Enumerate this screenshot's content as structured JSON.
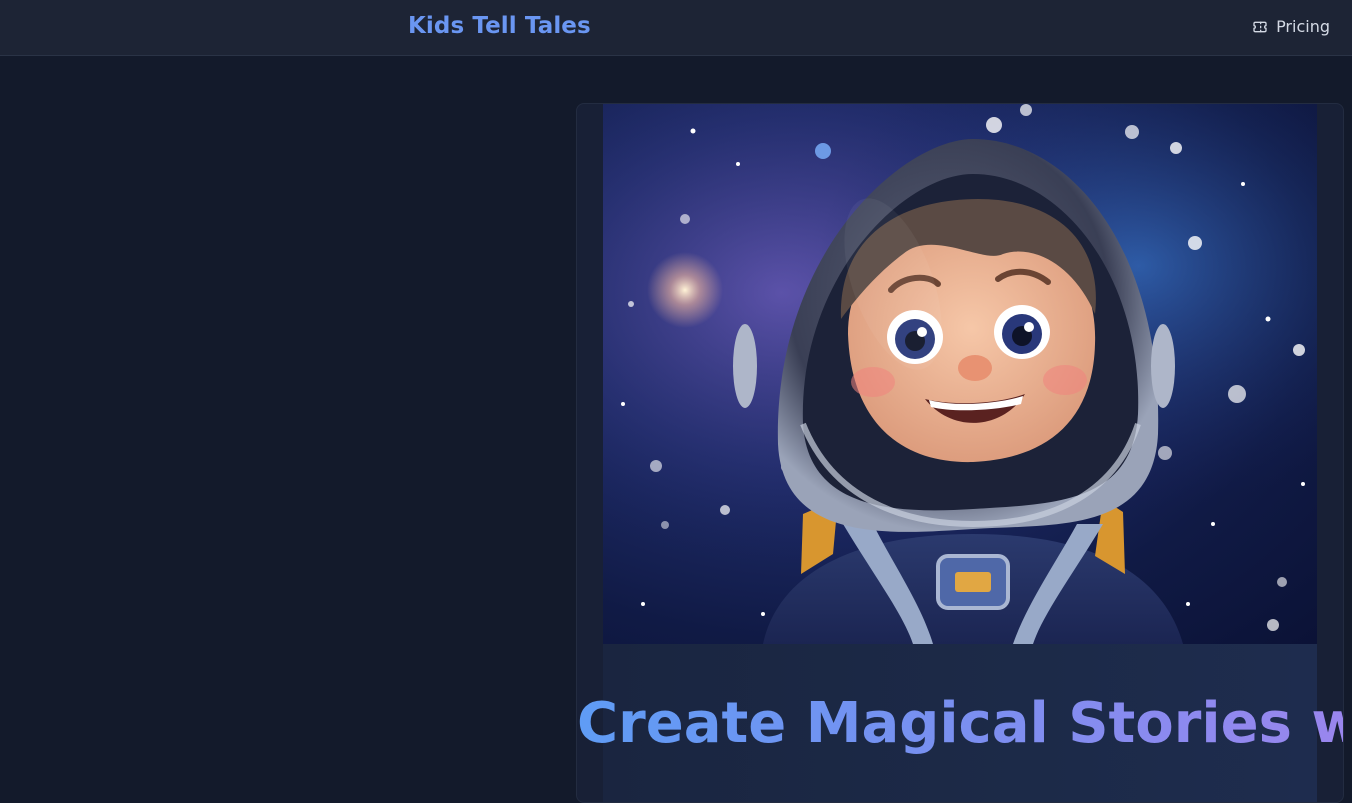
{
  "header": {
    "brand": "Kids Tell Tales",
    "nav": {
      "pricing_label": "Pricing",
      "pricing_icon": "ticket-icon"
    }
  },
  "hero": {
    "image_alt": "Smiling cartoon child astronaut in a helmet floating among stars",
    "headline": "Create Magical Stories with Your Child"
  },
  "colors": {
    "page_bg": "#131a2b",
    "header_bg": "#1d2435",
    "brand": "#6a96f2",
    "headline_gradient_start": "#5f9cf5",
    "headline_gradient_end": "#9a86ee"
  }
}
